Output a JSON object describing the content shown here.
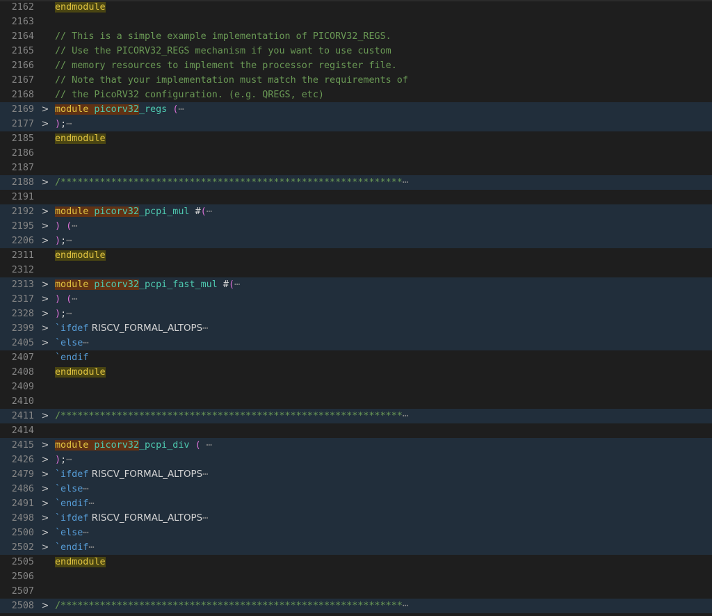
{
  "editor": {
    "lines": [
      {
        "ln": "2162",
        "fold": "",
        "folded": false,
        "seg": [
          [
            "end-word",
            "endmodule"
          ]
        ]
      },
      {
        "ln": "2163",
        "fold": "",
        "folded": false,
        "seg": []
      },
      {
        "ln": "2164",
        "fold": "",
        "folded": false,
        "seg": [
          [
            "comment",
            "// This is a simple example implementation of PICORV32_REGS."
          ]
        ]
      },
      {
        "ln": "2165",
        "fold": "",
        "folded": false,
        "seg": [
          [
            "comment",
            "// Use the PICORV32_REGS mechanism if you want to use custom"
          ]
        ]
      },
      {
        "ln": "2166",
        "fold": "",
        "folded": false,
        "seg": [
          [
            "comment",
            "// memory resources to implement the processor register file."
          ]
        ]
      },
      {
        "ln": "2167",
        "fold": "",
        "folded": false,
        "seg": [
          [
            "comment",
            "// Note that your implementation must match the requirements of"
          ]
        ]
      },
      {
        "ln": "2168",
        "fold": "",
        "folded": false,
        "seg": [
          [
            "comment",
            "// the PicoRV32 configuration. (e.g. QREGS, etc)"
          ]
        ]
      },
      {
        "ln": "2169",
        "fold": ">",
        "folded": true,
        "seg": [
          [
            "mod-first",
            "module"
          ],
          [
            "name-hl",
            " picorv32"
          ],
          [
            "name",
            "_regs "
          ],
          [
            "paren-pink",
            "("
          ],
          [
            "ellipsis",
            "⋯"
          ]
        ]
      },
      {
        "ln": "2177",
        "fold": ">",
        "folded": true,
        "seg": [
          [
            "paren-pink",
            ")"
          ],
          [
            "hash",
            ";"
          ],
          [
            "ellipsis",
            "⋯"
          ]
        ]
      },
      {
        "ln": "2185",
        "fold": "",
        "folded": false,
        "seg": [
          [
            "end-word",
            "endmodule"
          ]
        ]
      },
      {
        "ln": "2186",
        "fold": "",
        "folded": false,
        "seg": []
      },
      {
        "ln": "2187",
        "fold": "",
        "folded": false,
        "seg": []
      },
      {
        "ln": "2188",
        "fold": ">",
        "folded": true,
        "seg": [
          [
            "comment",
            "/*************************************************************"
          ],
          [
            "ellipsis",
            "⋯"
          ]
        ]
      },
      {
        "ln": "2191",
        "fold": "",
        "folded": false,
        "seg": []
      },
      {
        "ln": "2192",
        "fold": ">",
        "folded": true,
        "seg": [
          [
            "mod-first",
            "module"
          ],
          [
            "name-hl",
            " picorv32"
          ],
          [
            "name",
            "_pcpi_mul "
          ],
          [
            "hash",
            "#"
          ],
          [
            "paren-pink",
            "("
          ],
          [
            "ellipsis",
            "⋯"
          ]
        ]
      },
      {
        "ln": "2195",
        "fold": ">",
        "folded": true,
        "seg": [
          [
            "paren-pink",
            ") ("
          ],
          [
            "ellipsis",
            "⋯"
          ]
        ]
      },
      {
        "ln": "2206",
        "fold": ">",
        "folded": true,
        "seg": [
          [
            "paren-pink",
            ")"
          ],
          [
            "hash",
            ";"
          ],
          [
            "ellipsis",
            "⋯"
          ]
        ]
      },
      {
        "ln": "2311",
        "fold": "",
        "folded": false,
        "seg": [
          [
            "end-word",
            "endmodule"
          ]
        ]
      },
      {
        "ln": "2312",
        "fold": "",
        "folded": false,
        "seg": []
      },
      {
        "ln": "2313",
        "fold": ">",
        "folded": true,
        "seg": [
          [
            "mod-first",
            "module"
          ],
          [
            "name-hl",
            " picorv32"
          ],
          [
            "name",
            "_pcpi_fast_mul "
          ],
          [
            "hash",
            "#"
          ],
          [
            "paren-pink",
            "("
          ],
          [
            "ellipsis",
            "⋯"
          ]
        ]
      },
      {
        "ln": "2317",
        "fold": ">",
        "folded": true,
        "seg": [
          [
            "paren-pink",
            ") ("
          ],
          [
            "ellipsis",
            "⋯"
          ]
        ]
      },
      {
        "ln": "2328",
        "fold": ">",
        "folded": true,
        "seg": [
          [
            "paren-pink",
            ")"
          ],
          [
            "hash",
            ";"
          ],
          [
            "ellipsis",
            "⋯"
          ]
        ]
      },
      {
        "ln": "2399",
        "fold": ">",
        "folded": true,
        "seg": [
          [
            "directive",
            "`ifdef"
          ],
          [
            "macro",
            " RISCV_FORMAL_ALTOPS"
          ],
          [
            "ellipsis",
            "⋯"
          ]
        ]
      },
      {
        "ln": "2405",
        "fold": ">",
        "folded": true,
        "seg": [
          [
            "directive",
            "`else"
          ],
          [
            "ellipsis",
            "⋯"
          ]
        ]
      },
      {
        "ln": "2407",
        "fold": "",
        "folded": false,
        "seg": [
          [
            "directive",
            "`endif"
          ]
        ]
      },
      {
        "ln": "2408",
        "fold": "",
        "folded": false,
        "seg": [
          [
            "end-word",
            "endmodule"
          ]
        ]
      },
      {
        "ln": "2409",
        "fold": "",
        "folded": false,
        "seg": []
      },
      {
        "ln": "2410",
        "fold": "",
        "folded": false,
        "seg": []
      },
      {
        "ln": "2411",
        "fold": ">",
        "folded": true,
        "seg": [
          [
            "comment",
            "/*************************************************************"
          ],
          [
            "ellipsis",
            "⋯"
          ]
        ]
      },
      {
        "ln": "2414",
        "fold": "",
        "folded": false,
        "seg": []
      },
      {
        "ln": "2415",
        "fold": ">",
        "folded": true,
        "seg": [
          [
            "mod-first",
            "module"
          ],
          [
            "name-hl",
            " picorv32"
          ],
          [
            "name",
            "_pcpi_div "
          ],
          [
            "paren-pink",
            "("
          ],
          [
            "ellipsis",
            " ⋯"
          ]
        ]
      },
      {
        "ln": "2426",
        "fold": ">",
        "folded": true,
        "seg": [
          [
            "paren-pink",
            ")"
          ],
          [
            "hash",
            ";"
          ],
          [
            "ellipsis",
            "⋯"
          ]
        ]
      },
      {
        "ln": "2479",
        "fold": ">",
        "folded": true,
        "seg": [
          [
            "directive",
            "`ifdef"
          ],
          [
            "macro",
            " RISCV_FORMAL_ALTOPS"
          ],
          [
            "ellipsis",
            "⋯"
          ]
        ]
      },
      {
        "ln": "2486",
        "fold": ">",
        "folded": true,
        "seg": [
          [
            "directive",
            "`else"
          ],
          [
            "ellipsis",
            "⋯"
          ]
        ]
      },
      {
        "ln": "2491",
        "fold": ">",
        "folded": true,
        "seg": [
          [
            "directive",
            "`endif"
          ],
          [
            "ellipsis",
            "⋯"
          ]
        ]
      },
      {
        "ln": "2498",
        "fold": ">",
        "folded": true,
        "seg": [
          [
            "directive",
            "`ifdef"
          ],
          [
            "macro",
            " RISCV_FORMAL_ALTOPS"
          ],
          [
            "ellipsis",
            "⋯"
          ]
        ]
      },
      {
        "ln": "2500",
        "fold": ">",
        "folded": true,
        "seg": [
          [
            "directive",
            "`else"
          ],
          [
            "ellipsis",
            "⋯"
          ]
        ]
      },
      {
        "ln": "2502",
        "fold": ">",
        "folded": true,
        "seg": [
          [
            "directive",
            "`endif"
          ],
          [
            "ellipsis",
            "⋯"
          ]
        ]
      },
      {
        "ln": "2505",
        "fold": "",
        "folded": false,
        "seg": [
          [
            "end-word",
            "endmodule"
          ]
        ]
      },
      {
        "ln": "2506",
        "fold": "",
        "folded": false,
        "seg": []
      },
      {
        "ln": "2507",
        "fold": "",
        "folded": false,
        "seg": []
      },
      {
        "ln": "2508",
        "fold": ">",
        "folded": true,
        "seg": [
          [
            "comment",
            "/*************************************************************"
          ],
          [
            "ellipsis",
            "⋯"
          ]
        ]
      }
    ]
  }
}
